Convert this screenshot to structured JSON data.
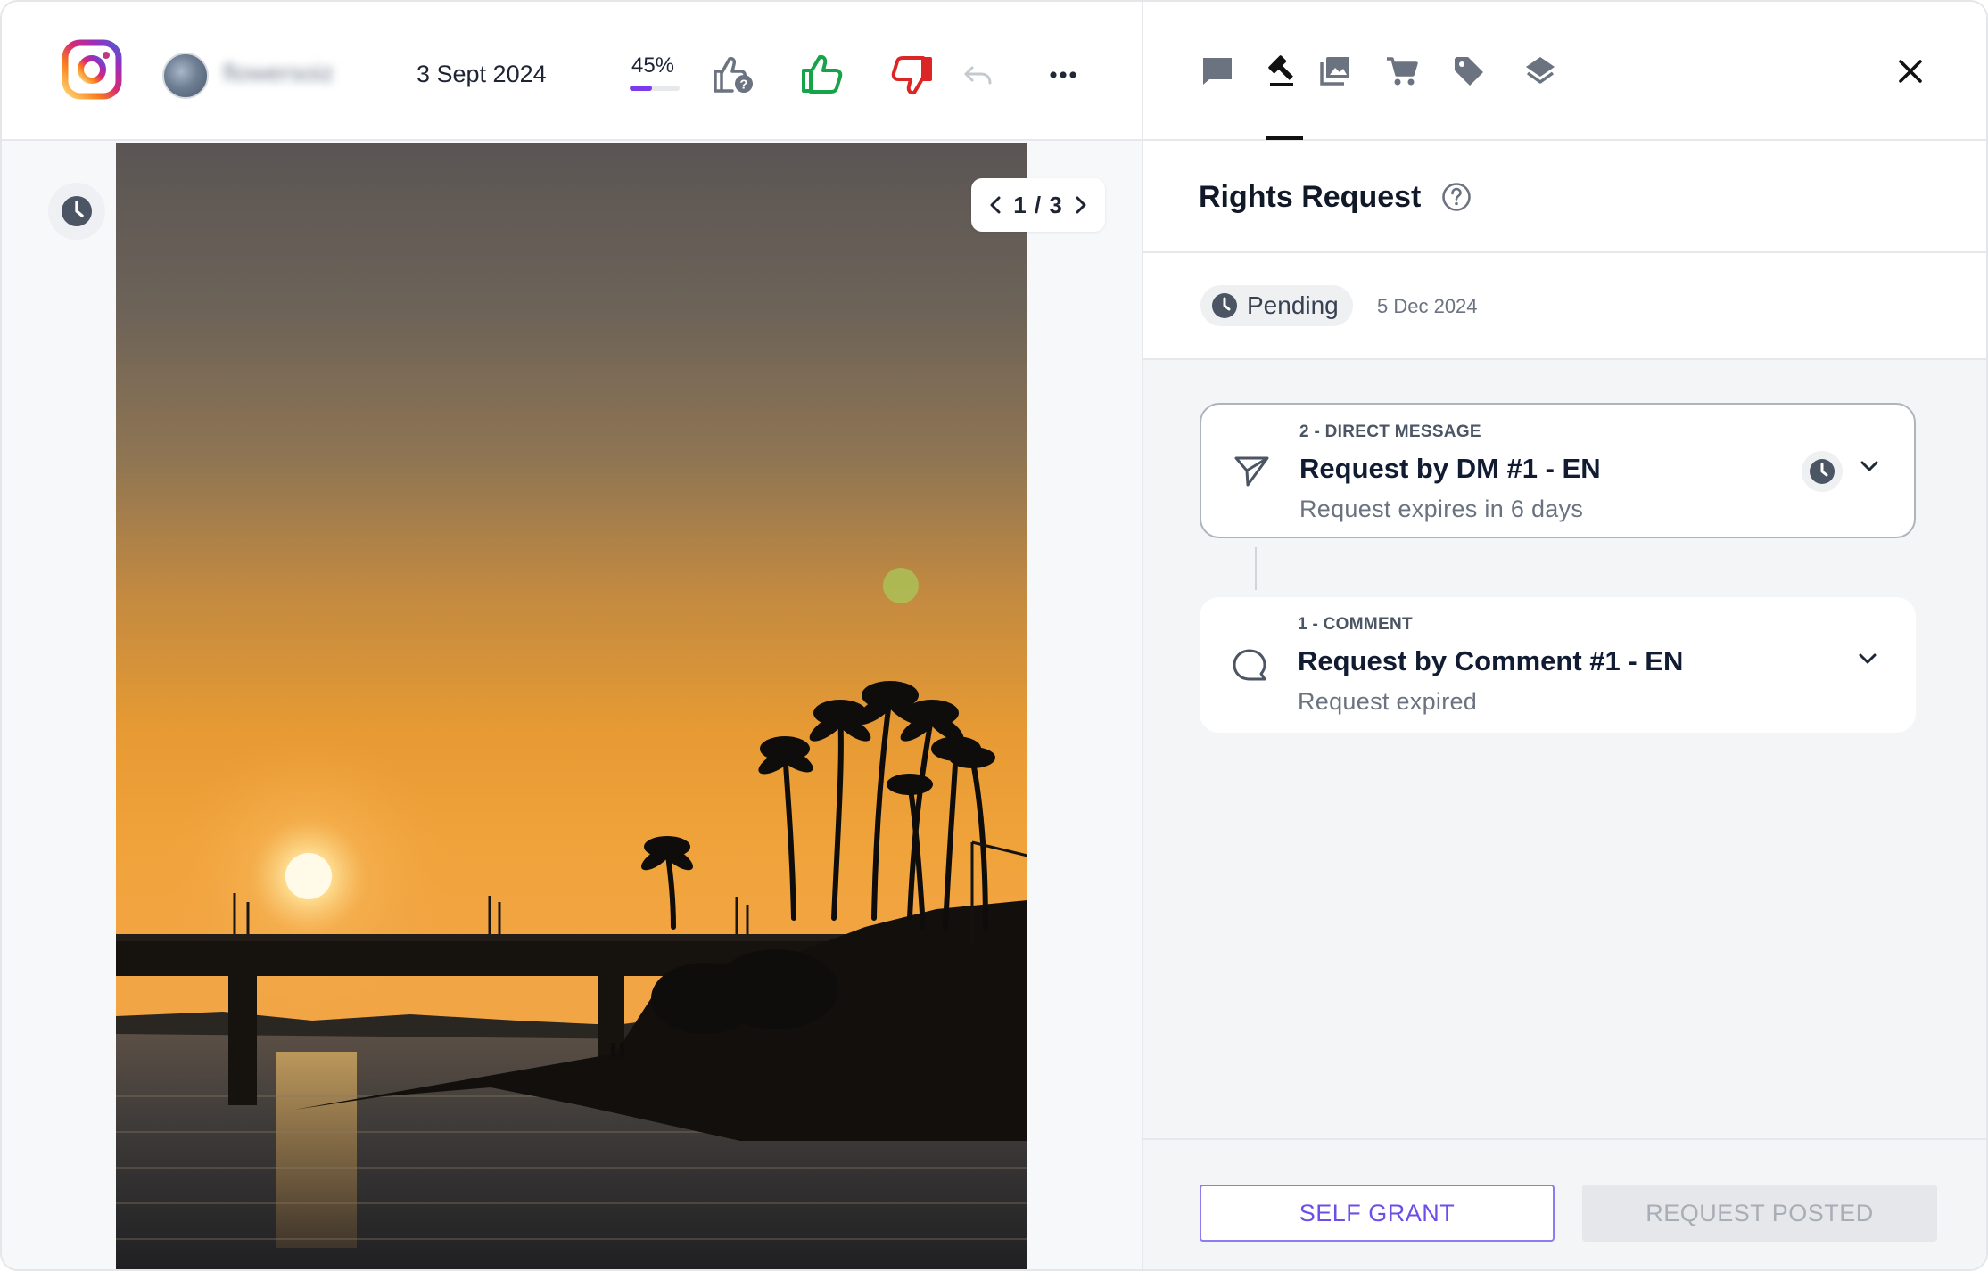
{
  "post": {
    "platform": "Instagram",
    "username": "flowersoiz",
    "date": "3 Sept 2024",
    "score_text": "45%",
    "score_value": 0.45,
    "pager": "1 / 3"
  },
  "toolbar": {
    "icons": [
      "thumb-up-question-icon",
      "thumb-up-icon",
      "thumb-down-icon",
      "undo-icon",
      "more-icon"
    ],
    "colors": {
      "approve": "#16a34a",
      "reject": "#dc2626",
      "accent": "#7c3aed"
    }
  },
  "panel": {
    "tabs": [
      "comment-tab",
      "rights-tab",
      "gallery-tab",
      "shop-tab",
      "tag-tab",
      "layers-tab"
    ],
    "active_tab": "rights-tab",
    "section_title": "Rights Request",
    "status_label": "Pending",
    "status_date": "5 Dec 2024",
    "requests": [
      {
        "kind": "2 - DIRECT MESSAGE",
        "title": "Request by DM #1 - EN",
        "subtitle": "Request expires in 6 days",
        "icon": "send-icon",
        "status_icon": "clock-icon"
      },
      {
        "kind": "1 - COMMENT",
        "title": "Request by Comment #1 - EN",
        "subtitle": "Request expired",
        "icon": "comment-bubble-icon"
      }
    ],
    "buttons": {
      "self_grant": "SELF GRANT",
      "request_posted": "REQUEST POSTED"
    }
  }
}
